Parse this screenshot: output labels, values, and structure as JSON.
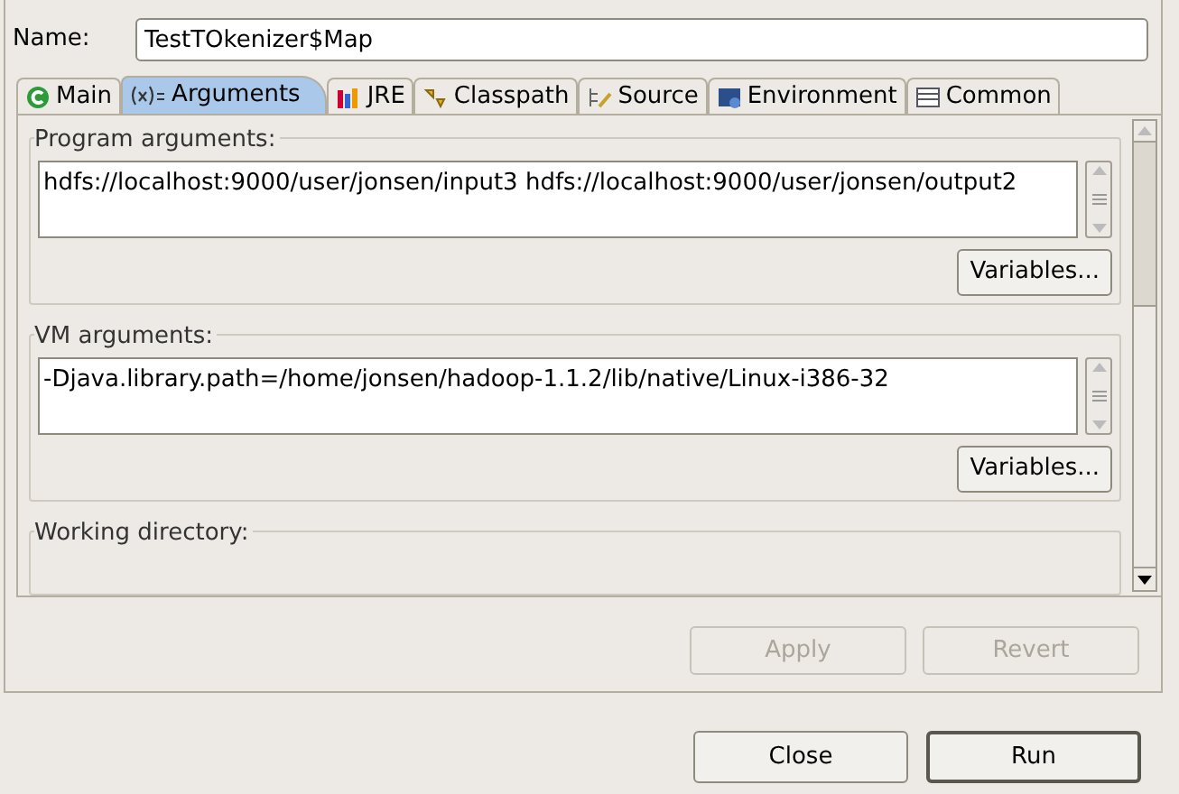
{
  "name_field": {
    "label": "Name:",
    "value": "TestTOkenizer$Map"
  },
  "tabs": [
    {
      "label": "Main",
      "kind": "main",
      "selected": false
    },
    {
      "label": "Arguments",
      "kind": "args",
      "selected": true
    },
    {
      "label": "JRE",
      "kind": "jre",
      "selected": false
    },
    {
      "label": "Classpath",
      "kind": "classpath",
      "selected": false
    },
    {
      "label": "Source",
      "kind": "source",
      "selected": false
    },
    {
      "label": "Environment",
      "kind": "env",
      "selected": false
    },
    {
      "label": "Common",
      "kind": "common",
      "selected": false
    }
  ],
  "groups": [
    {
      "title": "Program arguments:",
      "value": "hdfs://localhost:9000/user/jonsen/input3 hdfs://localhost:9000/user/jonsen/output2",
      "button": "Variables..."
    },
    {
      "title": "VM arguments:",
      "value": "-Djava.library.path=/home/jonsen/hadoop-1.1.2/lib/native/Linux-i386-32",
      "button": "Variables..."
    },
    {
      "title": "Working directory:"
    }
  ],
  "panel_buttons": [
    {
      "label": "Apply",
      "disabled": true
    },
    {
      "label": "Revert",
      "disabled": true
    }
  ],
  "dialog_buttons": [
    {
      "label": "Close",
      "default": false
    },
    {
      "label": "Run",
      "default": true
    }
  ]
}
